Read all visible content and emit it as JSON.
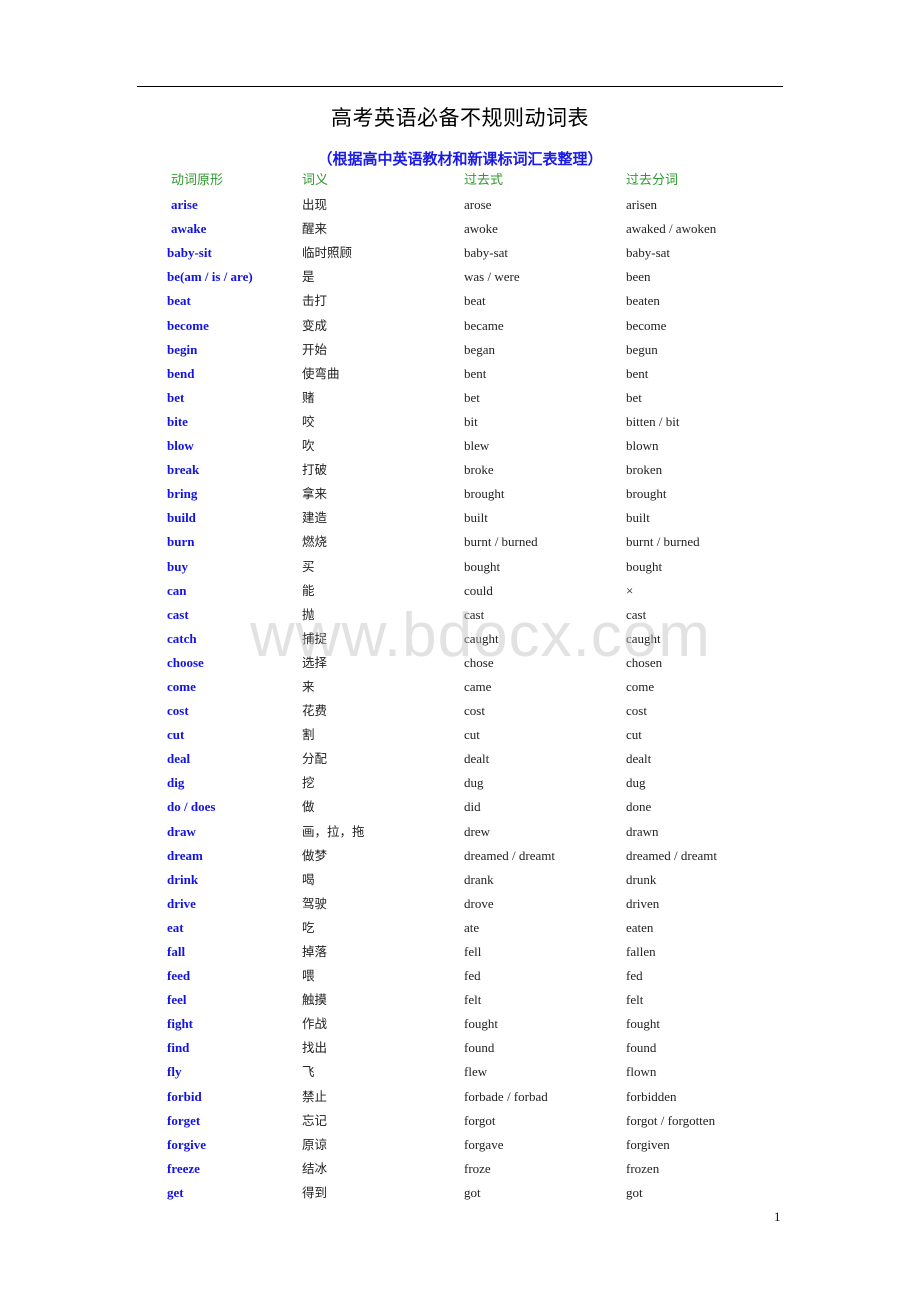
{
  "document": {
    "title": "高考英语必备不规则动词表",
    "subtitle": "（根据高中英语教材和新课标词汇表整理）",
    "watermark": "www.bdocx.com",
    "page_number": "1",
    "colors": {
      "verb": "#1414e0",
      "header": "#2f9a2f",
      "subtitle": "#1a1ae6"
    }
  },
  "table": {
    "headers": [
      "动词原形",
      "词义",
      "过去式",
      "过去分词"
    ],
    "rows": [
      {
        "verb": "arise",
        "meaning": "出现",
        "past": "arose",
        "pp": "arisen"
      },
      {
        "verb": "awake",
        "meaning": "醒来",
        "past": "awoke",
        "pp": "awaked / awoken"
      },
      {
        "verb": "baby-sit",
        "meaning": "临时照顾",
        "past": "baby-sat",
        "pp": "baby-sat"
      },
      {
        "verb": "be(am / is / are)",
        "meaning": "是",
        "past": "was / were",
        "pp": "been"
      },
      {
        "verb": "beat",
        "meaning": "击打",
        "past": "beat",
        "pp": "beaten"
      },
      {
        "verb": "become",
        "meaning": "变成",
        "past": "became",
        "pp": "become"
      },
      {
        "verb": "begin",
        "meaning": "开始",
        "past": "began",
        "pp": "begun"
      },
      {
        "verb": "bend",
        "meaning": "使弯曲",
        "past": "bent",
        "pp": "bent"
      },
      {
        "verb": "bet",
        "meaning": "赌",
        "past": "bet",
        "pp": "bet"
      },
      {
        "verb": "bite",
        "meaning": "咬",
        "past": "bit",
        "pp": "bitten / bit"
      },
      {
        "verb": "blow",
        "meaning": "吹",
        "past": "blew",
        "pp": "blown"
      },
      {
        "verb": "break",
        "meaning": "打破",
        "past": "broke",
        "pp": "broken"
      },
      {
        "verb": "bring",
        "meaning": "拿来",
        "past": "brought",
        "pp": "brought"
      },
      {
        "verb": "build",
        "meaning": "建造",
        "past": "built",
        "pp": "built"
      },
      {
        "verb": "burn",
        "meaning": "燃烧",
        "past": "burnt / burned",
        "pp": "burnt / burned"
      },
      {
        "verb": "buy",
        "meaning": "买",
        "past": "bought",
        "pp": "bought"
      },
      {
        "verb": "can",
        "meaning": "能",
        "past": "could",
        "pp": "×"
      },
      {
        "verb": "cast",
        "meaning": "抛",
        "past": "cast",
        "pp": "cast"
      },
      {
        "verb": "catch",
        "meaning": "捕捉",
        "past": "caught",
        "pp": "caught"
      },
      {
        "verb": "choose",
        "meaning": "选择",
        "past": "chose",
        "pp": "chosen"
      },
      {
        "verb": "come",
        "meaning": "来",
        "past": "came",
        "pp": "come"
      },
      {
        "verb": "cost",
        "meaning": "花费",
        "past": "cost",
        "pp": "cost"
      },
      {
        "verb": "cut",
        "meaning": "割",
        "past": "cut",
        "pp": "cut"
      },
      {
        "verb": "deal",
        "meaning": "分配",
        "past": "dealt",
        "pp": "dealt"
      },
      {
        "verb": "dig",
        "meaning": "挖",
        "past": "dug",
        "pp": "dug"
      },
      {
        "verb": "do / does",
        "meaning": "做",
        "past": "did",
        "pp": "done"
      },
      {
        "verb": "draw",
        "meaning": "画，拉，拖",
        "past": "drew",
        "pp": "drawn"
      },
      {
        "verb": "dream",
        "meaning": "做梦",
        "past": "dreamed / dreamt",
        "pp": "dreamed / dreamt"
      },
      {
        "verb": "drink",
        "meaning": "喝",
        "past": "drank",
        "pp": "drunk"
      },
      {
        "verb": "drive",
        "meaning": "驾驶",
        "past": "drove",
        "pp": "driven"
      },
      {
        "verb": "eat",
        "meaning": "吃",
        "past": "ate",
        "pp": "eaten"
      },
      {
        "verb": "fall",
        "meaning": "掉落",
        "past": "fell",
        "pp": "fallen"
      },
      {
        "verb": "feed",
        "meaning": "喂",
        "past": "fed",
        "pp": "fed"
      },
      {
        "verb": "feel",
        "meaning": "触摸",
        "past": "felt",
        "pp": "felt"
      },
      {
        "verb": "fight",
        "meaning": "作战",
        "past": "fought",
        "pp": "fought"
      },
      {
        "verb": "find",
        "meaning": "找出",
        "past": "found",
        "pp": "found"
      },
      {
        "verb": "fly",
        "meaning": "飞",
        "past": "flew",
        "pp": "flown"
      },
      {
        "verb": "forbid",
        "meaning": "禁止",
        "past": "forbade / forbad",
        "pp": "forbidden"
      },
      {
        "verb": "forget",
        "meaning": "忘记",
        "past": "forgot",
        "pp": "forgot / forgotten"
      },
      {
        "verb": "forgive",
        "meaning": "原谅",
        "past": "forgave",
        "pp": "forgiven"
      },
      {
        "verb": "freeze",
        "meaning": "结冰",
        "past": "froze",
        "pp": "frozen"
      },
      {
        "verb": "get",
        "meaning": "得到",
        "past": "got",
        "pp": "got"
      }
    ]
  }
}
